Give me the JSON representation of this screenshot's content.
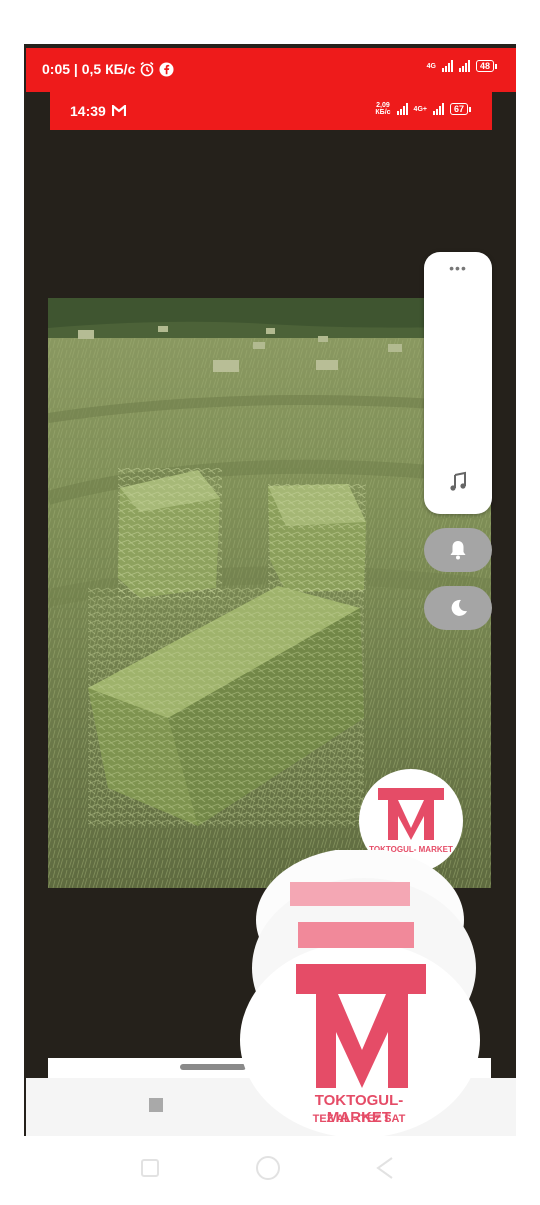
{
  "status_outer": {
    "text": "0:05 | 0,5 КБ/с",
    "network": "4G",
    "battery": "48"
  },
  "status_inner": {
    "time": "14:39",
    "app_icon": "gmail-icon",
    "speed_value": "2,09",
    "speed_unit": "КБ/с",
    "network": "4G+",
    "battery": "67"
  },
  "colors": {
    "status_red": "#ee1b1b",
    "screen_bg": "#25211b",
    "logo_pink": "#e54c67"
  },
  "side_panel": {
    "menu_icon": "more-dots-icon",
    "music_icon": "music-note-icon",
    "bell_icon": "bell-icon",
    "moon_icon": "moon-icon"
  },
  "watermark": {
    "brand": "TOKTOGUL- MARKET",
    "slogan": "TEZ AL - TEZ SAT"
  }
}
